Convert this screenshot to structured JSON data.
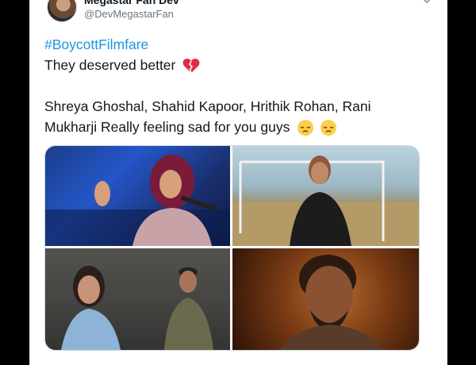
{
  "tweet": {
    "display_name": "Megastar Fan Dev",
    "handle": "@DevMegastarFan",
    "hashtag": "#BoycottFilmfare",
    "line1": "They deserved better",
    "line3": "Shreya Ghoshal, Shahid Kapoor, Hrithik Rohan, Rani",
    "line4": "Mukharji Really feeling sad for you guys"
  },
  "icons": {
    "broken_heart": "broken-heart-emoji",
    "pensive": "pensive-face-emoji",
    "chevron": "chevron-down-icon"
  },
  "colors": {
    "hashtag": "#1b95e0",
    "text": "#14171a",
    "secondary": "#657786"
  },
  "media": {
    "photos": [
      {
        "label": "singer-performing-photo"
      },
      {
        "label": "footballer-in-field-photo"
      },
      {
        "label": "woman-and-officer-photo"
      },
      {
        "label": "bearded-man-closeup-photo"
      }
    ]
  }
}
